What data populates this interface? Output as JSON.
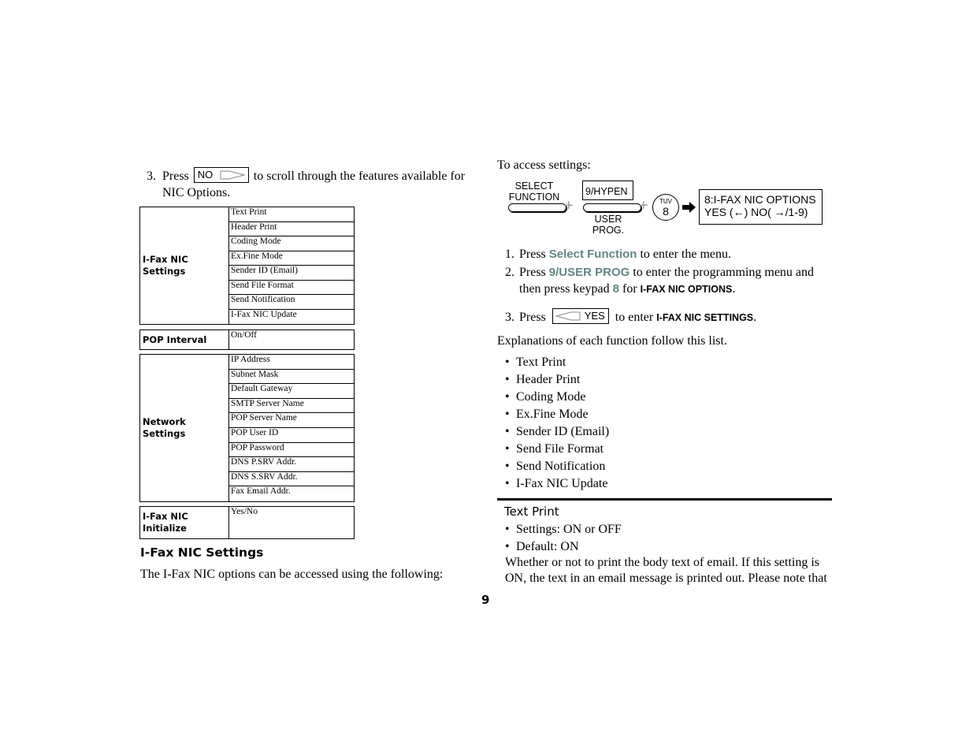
{
  "left": {
    "step3": {
      "number": "3.",
      "press": "Press",
      "key_label": "NO",
      "key_icon": "right-arrow-outline-icon",
      "text_line1": "to scroll through the features available for",
      "text_line2": "NIC Options."
    },
    "groups": [
      {
        "header": "I-Fax NIC Settings",
        "items": [
          "Text Print",
          "Header Print",
          "Coding Mode",
          "Ex.Fine Mode",
          "Sender ID (Email)",
          "Send File Format",
          "Send Notification",
          "I-Fax NIC Update"
        ]
      },
      {
        "header": "POP Interval",
        "items": [
          "On/Off"
        ]
      },
      {
        "header": "Network Settings",
        "items": [
          "IP Address",
          "Subnet Mask",
          "Default Gateway",
          "SMTP Server Name",
          "POP Server Name",
          "POP User ID",
          "POP Password",
          "DNS P.SRV Addr.",
          "DNS S.SRV Addr.",
          "Fax Email Addr."
        ]
      },
      {
        "header_line1": "I-Fax NIC",
        "header_line2": "Initialize",
        "items": [
          "Yes/No"
        ]
      }
    ],
    "section_title": "I-Fax NIC Settings",
    "section_body": "The I-Fax NIC options can be accessed using the following:"
  },
  "page_number": "9",
  "right": {
    "access_intro": "To access settings:",
    "diagram": {
      "select_line1": "SELECT",
      "select_line2": "FUNCTION",
      "plus": "+",
      "hypen_label": "9/HYPEN",
      "user_line1": "USER",
      "user_line2": "PROG.",
      "key8_letters": "TUV",
      "key8_digit": "8",
      "arrow_icon": "right-arrow-icon",
      "lcd_line1": "8:I-FAX NIC OPTIONS",
      "lcd_line2": "YES (←)  NO( →/1-9)"
    },
    "steps": [
      {
        "number": "1.",
        "pre": "Press",
        "accent": "Select Function",
        "post": "to enter the menu."
      },
      {
        "number": "2.",
        "pre": "Press",
        "accent": "9/USER PROG",
        "post": "to enter the programming menu and",
        "line2_pre": "then press keypad",
        "line2_accent": "8",
        "line2_mid": "for",
        "line2_bold": "I-FAX NIC OPTIONS",
        "line2_post": "."
      },
      {
        "number": "3.",
        "pre": "Press",
        "key_label": "YES",
        "key_icon": "left-arrow-outline-icon",
        "post": "to enter",
        "bold": "I-FAX NIC SETTINGS",
        "end": "."
      }
    ],
    "explanations_intro": "Explanations of each function follow this list.",
    "function_list": [
      "Text Print",
      "Header Print",
      "Coding Mode",
      "Ex.Fine Mode",
      "Sender ID (Email)",
      "Send File Format",
      "Send Notification",
      "I-Fax NIC Update"
    ],
    "text_print": {
      "title": "Text Print",
      "bullets": [
        "Settings:  ON or OFF",
        "Default:  ON"
      ],
      "body": "Whether or not to print the body text of email. If this setting is ON, the text in an email message is printed out. Please note that"
    }
  },
  "colors": {
    "accent": "#5f8785",
    "text": "#000000",
    "plus_gray": "#9a9a9a"
  }
}
